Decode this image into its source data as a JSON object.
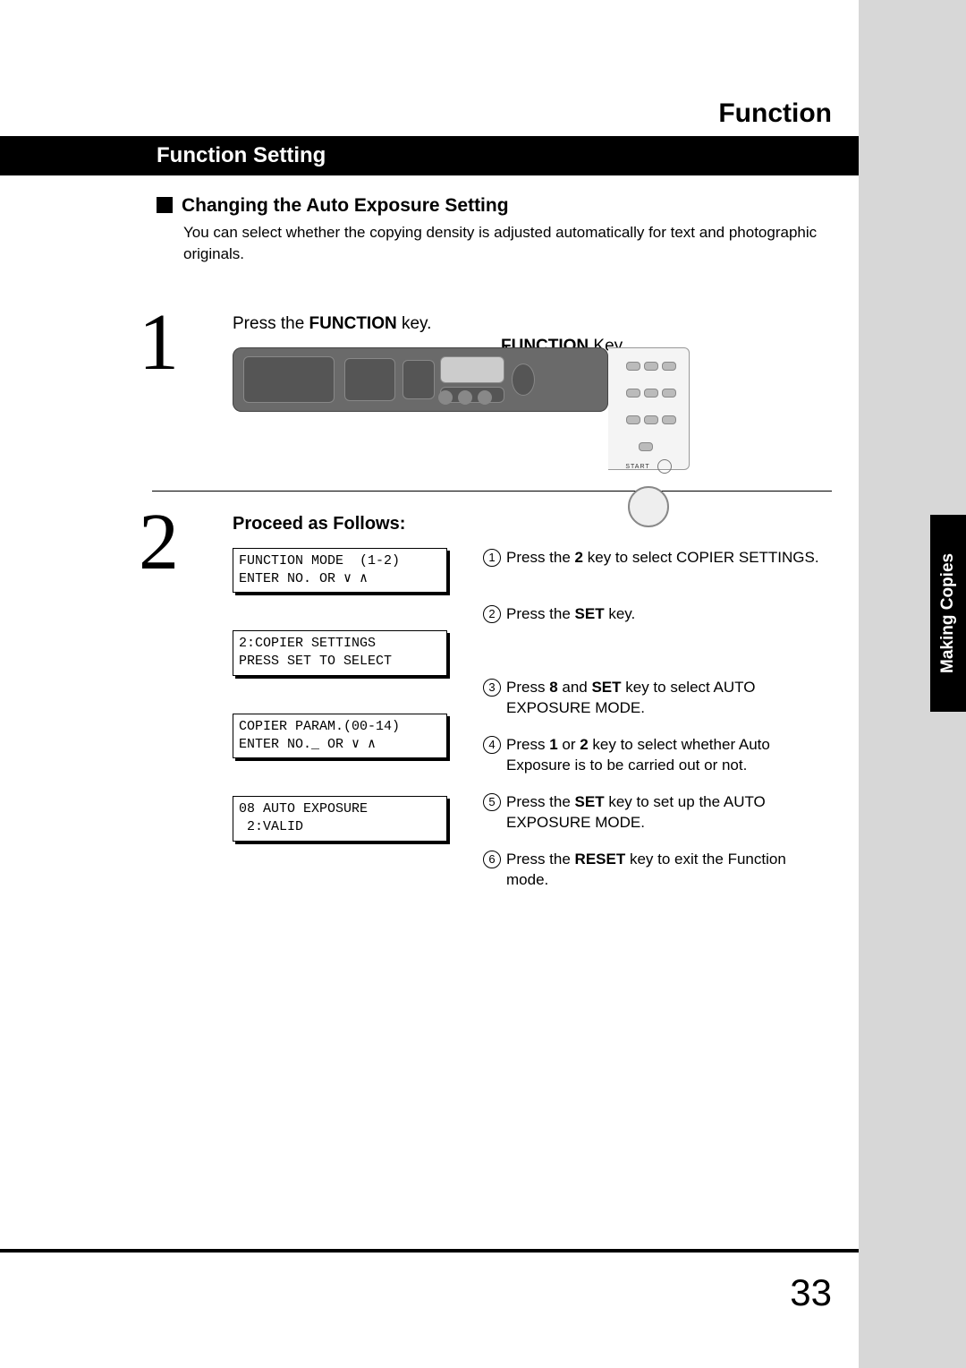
{
  "header": {
    "page_title": "Function"
  },
  "bar": {
    "title": "Function Setting"
  },
  "sub": {
    "heading": "Changing the Auto Exposure Setting",
    "intro": "You can select whether the copying density is adjusted automatically for text and photographic originals."
  },
  "step1": {
    "num": "1",
    "text_pre": "Press the ",
    "text_bold": "FUNCTION",
    "text_post": " key.",
    "callout_bold": "FUNCTION",
    "callout_rest": " Key",
    "panel_start": "START"
  },
  "step2": {
    "num": "2",
    "heading": "Proceed as Follows:",
    "lcd1_l1": "FUNCTION MODE  (1-2)",
    "lcd1_l2": "ENTER NO. OR ∨ ∧",
    "lcd2_l1": "2:COPIER SETTINGS",
    "lcd2_l2": "PRESS SET TO SELECT",
    "lcd3_l1": "COPIER PARAM.(00-14)",
    "lcd3_l2": "ENTER NO._ OR ∨ ∧",
    "lcd4_l1": "08 AUTO EXPOSURE",
    "lcd4_l2": " 2:VALID",
    "i1_n": "1",
    "i1_a": "Press the ",
    "i1_b": "2",
    "i1_c": " key to select COPIER SETTINGS.",
    "i2_n": "2",
    "i2_a": "Press the ",
    "i2_b": "SET",
    "i2_c": " key.",
    "i3_n": "3",
    "i3_a": "Press ",
    "i3_b": "8",
    "i3_c": " and ",
    "i3_d": "SET",
    "i3_e": " key to select AUTO EXPOSURE MODE.",
    "i4_n": "4",
    "i4_a": "Press ",
    "i4_b": "1",
    "i4_c": " or ",
    "i4_d": "2",
    "i4_e": " key to select whether Auto Exposure is to be carried out or not.",
    "i5_n": "5",
    "i5_a": "Press the ",
    "i5_b": "SET",
    "i5_c": " key to set up the AUTO EXPOSURE MODE.",
    "i6_n": "6",
    "i6_a": "Press the ",
    "i6_b": "RESET",
    "i6_c": " key to exit the Function mode."
  },
  "sidetab": "Making Copies",
  "page_number": "33"
}
